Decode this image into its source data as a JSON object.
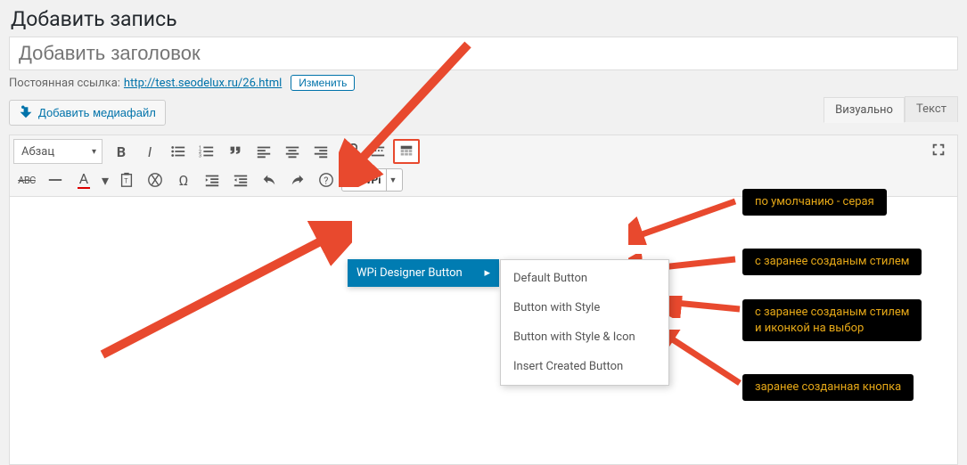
{
  "page_title": "Добавить запись",
  "title_placeholder": "Добавить заголовок",
  "permalink": {
    "label": "Постоянная ссылка:",
    "url": "http://test.seodelux.ru/26.html",
    "edit": "Изменить"
  },
  "media_button": "Добавить медиафайл",
  "tabs": {
    "visual": "Визуально",
    "text": "Текст"
  },
  "format_dropdown": "Абзац",
  "wpi_button": "WPi",
  "dropdown": {
    "title": "WPi Designer Button",
    "items": [
      "Default Button",
      "Button with Style",
      "Button with Style & Icon",
      "Insert Created Button"
    ]
  },
  "annotations": [
    "по умолчанию - серая",
    "с заранее созданым стилем",
    "с заранее созданым стилем\nи иконкой на выбор",
    "заранее созданная кнопка"
  ]
}
